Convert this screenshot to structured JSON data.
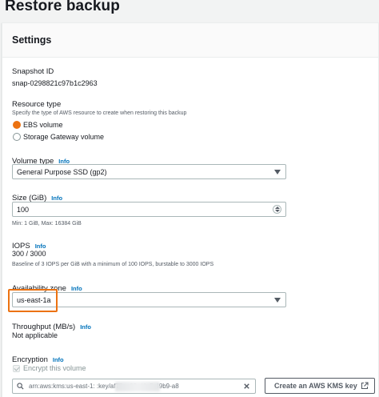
{
  "page": {
    "title": "Restore backup"
  },
  "settings": {
    "title": "Settings",
    "snapshot": {
      "label": "Snapshot ID",
      "value": "snap-0298821c97b1c2963"
    },
    "resource_type": {
      "label": "Resource type",
      "description": "Specify the type of AWS resource to create when restoring this backup",
      "options": [
        "EBS volume",
        "Storage Gateway volume"
      ],
      "selected": "EBS volume"
    },
    "volume_type": {
      "label": "Volume type",
      "info": "Info",
      "value": "General Purpose SSD (gp2)"
    },
    "size": {
      "label": "Size (GiB)",
      "info": "Info",
      "value": "100",
      "constraint": "Min: 1 GiB, Max: 16384 GiB"
    },
    "iops": {
      "label": "IOPS",
      "info": "Info",
      "value": "300 / 3000",
      "description": "Baseline of 3 IOPS per GiB with a minimum of 100 IOPS, burstable to 3000 IOPS"
    },
    "availability_zone": {
      "label": "Availability zone",
      "info": "Info",
      "value": "us-east-1a"
    },
    "throughput": {
      "label": "Throughput (MB/s)",
      "info": "Info",
      "value": "Not applicable"
    },
    "encryption": {
      "label": "Encryption",
      "info": "Info",
      "checkbox_label": "Encrypt this volume",
      "kms_key_value": "arn:aws:kms:us-east-1:                    :key/af75ae02-d4a5-49b9-a8",
      "kms_button_label": "Create an AWS KMS key"
    }
  },
  "colors": {
    "accent": "#ec7211",
    "link": "#0073bb",
    "text": "#16191f",
    "muted": "#545b64"
  }
}
